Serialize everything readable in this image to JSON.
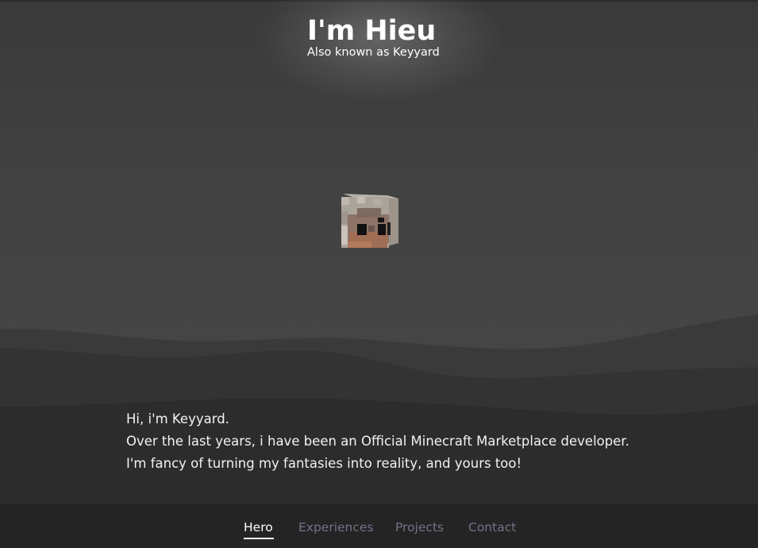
{
  "hero": {
    "title": "I'm Hieu",
    "subtitle": "Also known as Keyyard",
    "avatar_icon": "minecraft-skin-head-icon"
  },
  "bio": {
    "lines": [
      "Hi, i'm Keyyard.",
      "Over the last years, i have been an Official Minecraft Marketplace developer.",
      "I'm fancy of turning my fantasies into reality, and yours too!"
    ]
  },
  "nav": {
    "items": [
      {
        "label": "Hero",
        "active": true
      },
      {
        "label": "Experiences",
        "active": false
      },
      {
        "label": "Projects",
        "active": false
      },
      {
        "label": "Contact",
        "active": false
      }
    ]
  },
  "colors": {
    "background": "#454545",
    "hill_far": "#3a3a3a",
    "hill_mid": "#333333",
    "hill_near": "#2c2c2c",
    "navbar": "#242424",
    "nav_active": "#ffffff",
    "nav_inactive": "#6f7486",
    "text": "#ffffff"
  }
}
